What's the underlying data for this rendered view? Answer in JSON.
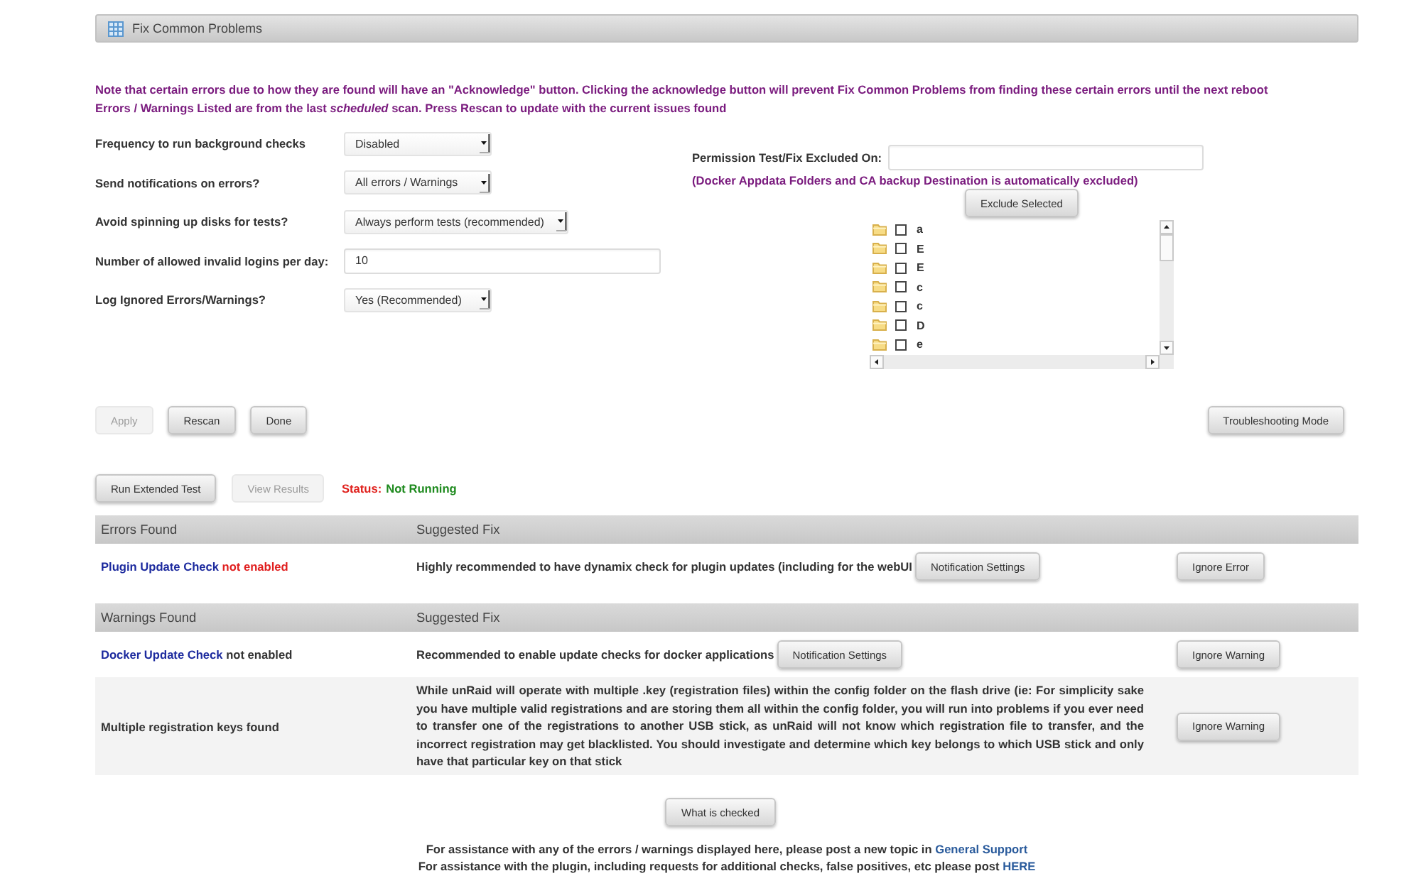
{
  "header": {
    "title": "Fix Common Problems"
  },
  "notice": [
    "Note that certain errors due to how they are found will have an \"Acknowledge\" button. Clicking the acknowledge button will prevent Fix Common Problems from finding these certain errors until the next reboot",
    "Errors / Warnings Listed are from the last *scheduled* scan. Press Rescan to update with the current issues found"
  ],
  "settings": [
    {
      "kind": "select",
      "label": "Frequency to run background checks",
      "value": "Disabled"
    },
    {
      "kind": "select",
      "label": "Send notifications on errors?",
      "value": "All errors / Warnings"
    },
    {
      "kind": "select",
      "label": "Avoid spinning up disks for tests?",
      "value": "Always perform tests (recommended)"
    },
    {
      "kind": "input",
      "label": "Number of allowed invalid logins per day:",
      "value": "10"
    },
    {
      "kind": "select",
      "label": "Log Ignored Errors/Warnings?",
      "value": "Yes (Recommended)"
    }
  ],
  "exclusions": {
    "label": "Permission Test/Fix Excluded On:",
    "note": "(Docker Appdata Folders and CA backup Destination is automatically excluded)",
    "button": "Exclude Selected",
    "folders": [
      {
        "name": "a",
        "checked": false
      },
      {
        "name": "E",
        "checked": false
      },
      {
        "name": "E",
        "checked": false
      },
      {
        "name": "c",
        "checked": false
      },
      {
        "name": "c",
        "checked": false
      },
      {
        "name": "D",
        "checked": false
      },
      {
        "name": "e",
        "checked": false
      }
    ]
  },
  "actions": [
    {
      "label": "Apply",
      "disabled": true
    },
    {
      "label": "Rescan",
      "disabled": false
    },
    {
      "label": "Done",
      "disabled": false
    }
  ],
  "troubleshooting_button": "Troubleshooting Mode",
  "extended_test": {
    "buttons": [
      {
        "label": "Run Extended Test",
        "disabled": false
      },
      {
        "label": "View Results",
        "disabled": true
      }
    ],
    "status_label": "Status:",
    "status_value": "Not Running"
  },
  "tables": [
    {
      "kind": "errors",
      "columns": [
        "Errors Found",
        "Suggested Fix"
      ],
      "rows": [
        {
          "link": "Plugin Update Check",
          "title": "not enabled",
          "fix": "Highly recommended to have dynamix check for plugin updates (including for the webUI",
          "fix_button": "Notification Settings",
          "action": "Ignore Error"
        }
      ]
    },
    {
      "kind": "warnings",
      "columns": [
        "Warnings Found",
        "Suggested Fix"
      ],
      "rows": [
        {
          "link": "Docker Update Check",
          "title": "not enabled",
          "fix": "Recommended to enable update checks for docker applications",
          "fix_button": "Notification Settings",
          "action": "Ignore Warning"
        },
        {
          "title": "Multiple registration keys found",
          "fix": "While unRaid will operate with multiple .key (registration files) within the config folder on the flash drive (ie: For simplicity sake you have multiple valid registrations and are storing them all within the config folder, you will run into problems if you ever need to transfer one of the registrations to another USB stick, as unRaid will not know which registration file to transfer, and the incorrect registration may get blacklisted. You should investigate and determine which key belongs to which USB stick and only have that particular key on that stick",
          "action": "Ignore Warning"
        }
      ]
    }
  ],
  "check_button": "What is checked",
  "footer": [
    {
      "text": "For assistance with any of the errors / warnings displayed here, please post a new topic in",
      "link": "General Support"
    },
    {
      "text": "For assistance with the plugin, including requests for additional checks, false positives, etc please post",
      "link": "HERE"
    }
  ]
}
